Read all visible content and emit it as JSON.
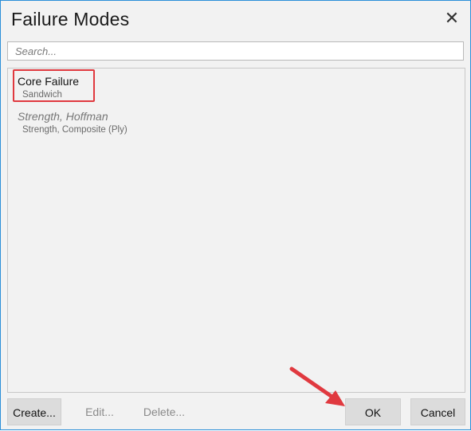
{
  "dialog": {
    "title": "Failure Modes",
    "close_icon": "close-icon"
  },
  "search": {
    "placeholder": "Search...",
    "value": ""
  },
  "list": {
    "items": [
      {
        "name": "Core Failure",
        "category": "Sandwich",
        "state": "highlighted"
      },
      {
        "name": "Strength, Hoffman",
        "category": "Strength, Composite (Ply)",
        "state": "disabled"
      }
    ]
  },
  "buttons": {
    "create": "Create...",
    "edit": "Edit...",
    "delete": "Delete...",
    "ok": "OK",
    "cancel": "Cancel"
  },
  "colors": {
    "accent_border": "#2b8fd8",
    "annotation_red": "#e0393f"
  }
}
